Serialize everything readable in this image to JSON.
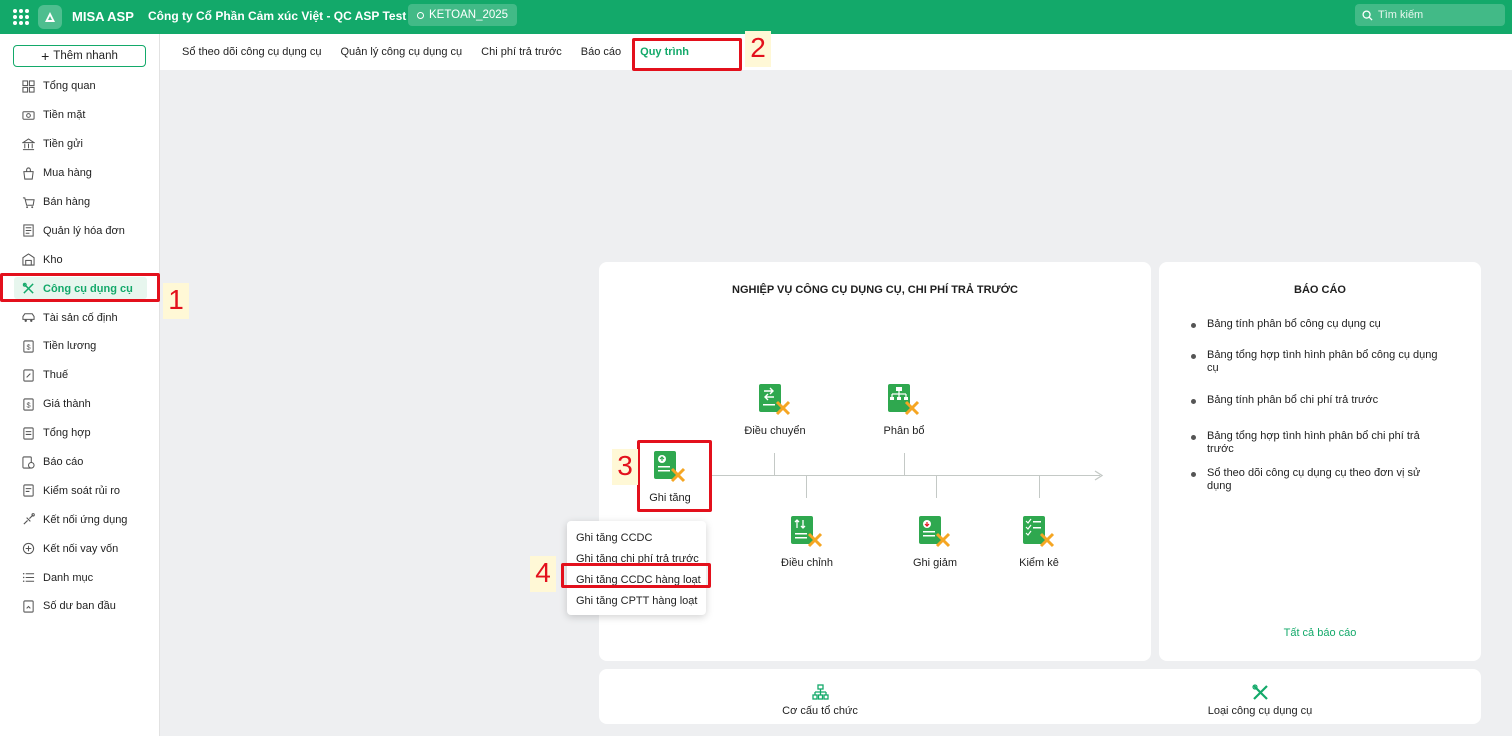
{
  "header": {
    "app_name": "MISA ASP",
    "company": "Công ty Cổ Phần Cảm xúc Việt - QC ASP Test",
    "database": "KETOAN_2025",
    "search_placeholder": "Tìm kiếm"
  },
  "sidebar": {
    "quick_add": "Thêm nhanh",
    "items": [
      {
        "label": "Tổng quan",
        "icon": "dashboard-icon"
      },
      {
        "label": "Tiền mặt",
        "icon": "cash-icon"
      },
      {
        "label": "Tiền gửi",
        "icon": "bank-icon"
      },
      {
        "label": "Mua hàng",
        "icon": "shopping-bag-icon"
      },
      {
        "label": "Bán hàng",
        "icon": "cart-icon"
      },
      {
        "label": "Quản lý hóa đơn",
        "icon": "invoice-icon"
      },
      {
        "label": "Kho",
        "icon": "warehouse-icon"
      },
      {
        "label": "Công cụ dụng cụ",
        "icon": "tools-icon",
        "active": true
      },
      {
        "label": "Tài sản cố định",
        "icon": "car-icon"
      },
      {
        "label": "Tiền lương",
        "icon": "salary-icon"
      },
      {
        "label": "Thuế",
        "icon": "tax-icon"
      },
      {
        "label": "Giá thành",
        "icon": "cost-icon"
      },
      {
        "label": "Tổng hợp",
        "icon": "summary-icon"
      },
      {
        "label": "Báo cáo",
        "icon": "report-icon"
      },
      {
        "label": "Kiểm soát rủi ro",
        "icon": "risk-icon"
      },
      {
        "label": "Kết nối ứng dụng",
        "icon": "plug-icon"
      },
      {
        "label": "Kết nối vay vốn",
        "icon": "loan-icon"
      },
      {
        "label": "Danh mục",
        "icon": "list-icon"
      },
      {
        "label": "Số dư ban đầu",
        "icon": "opening-balance-icon"
      }
    ]
  },
  "tabs": [
    {
      "label": "Sổ theo dõi công cụ dụng cụ"
    },
    {
      "label": "Quản lý công cụ dụng cụ"
    },
    {
      "label": "Chi phí trả trước"
    },
    {
      "label": "Báo cáo"
    },
    {
      "label": "Quy trình",
      "active": true
    }
  ],
  "process": {
    "title": "NGHIỆP VỤ CÔNG CỤ DỤNG CỤ, CHI PHÍ TRẢ TRƯỚC",
    "nodes": {
      "ghi_tang": "Ghi tăng",
      "dieu_chuyen": "Điều chuyển",
      "phan_bo": "Phân bổ",
      "dieu_chinh": "Điều chỉnh",
      "ghi_giam": "Ghi giảm",
      "kiem_ke": "Kiểm kê"
    },
    "dropdown": [
      "Ghi tăng CCDC",
      "Ghi tăng chi phí trả trước",
      "Ghi tăng CCDC hàng loạt",
      "Ghi tăng CPTT hàng loạt"
    ]
  },
  "reports": {
    "title": "BÁO CÁO",
    "items": [
      "Bảng tính phân bổ công cụ dụng cụ",
      "Bảng tổng hợp tình hình phân bổ công cụ dụng cụ",
      "Bảng tính phân bổ chi phí trả trước",
      "Bảng tổng hợp tình hình phân bổ chi phí trả trước",
      "Sổ theo dõi công cụ dụng cụ theo đơn vị sử dụng"
    ],
    "all_link": "Tất cả báo cáo"
  },
  "bottom": {
    "org": "Cơ cấu tổ chức",
    "tool_type": "Loại công cụ dụng cụ"
  },
  "annotations": [
    "1",
    "2",
    "3",
    "4"
  ],
  "colors": {
    "brand": "#13a96a",
    "annotation": "#e3101c"
  }
}
